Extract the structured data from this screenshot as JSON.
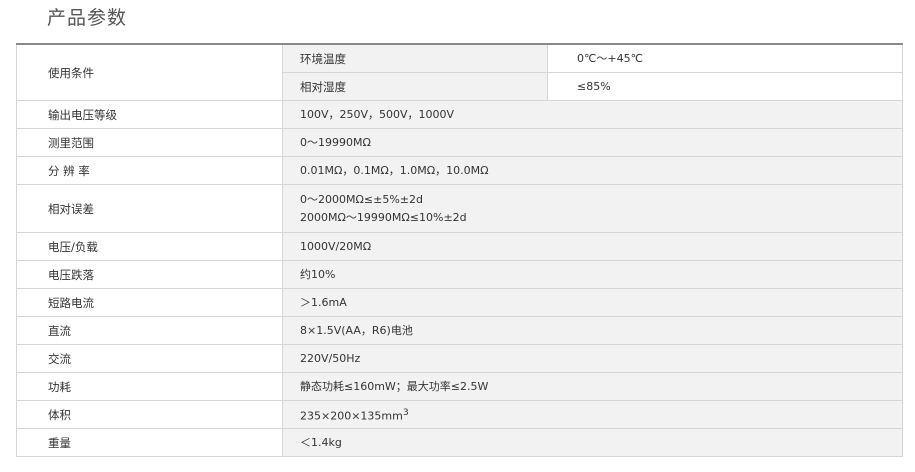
{
  "page": {
    "title": "产品参数"
  },
  "conditions": {
    "label": "使用条件",
    "temp_label": "环境温度",
    "temp_value": "0℃～+45℃",
    "humidity_label": "相对湿度",
    "humidity_value": "≤85%"
  },
  "rows": [
    {
      "label": "输出电压等级",
      "value": "100V，250V，500V，1000V"
    },
    {
      "label": "测里范围",
      "value": "0～19990MΩ"
    },
    {
      "label": "分 辨 率",
      "value": "0.01MΩ，0.1MΩ，1.0MΩ，10.0MΩ"
    },
    {
      "label": "相对误差",
      "line1": "0～2000MΩ≤±5%±2d",
      "line2": "2000MΩ～19990MΩ≤10%±2d"
    },
    {
      "label": "电压/负载",
      "value": "1000V/20MΩ"
    },
    {
      "label": "电压跌落",
      "value": "约10%"
    },
    {
      "label": "短路电流",
      "value": "＞1.6mA"
    },
    {
      "label": "直流",
      "value": "8×1.5V(AA，R6)电池"
    },
    {
      "label": "交流",
      "value": "220V/50Hz"
    },
    {
      "label": "功耗",
      "value": "静态功耗≤160mW；最大功率≤2.5W"
    },
    {
      "label": "体积",
      "value": "235×200×135mm",
      "sup": "3"
    },
    {
      "label": "重量",
      "value": "＜1.4kg"
    }
  ]
}
